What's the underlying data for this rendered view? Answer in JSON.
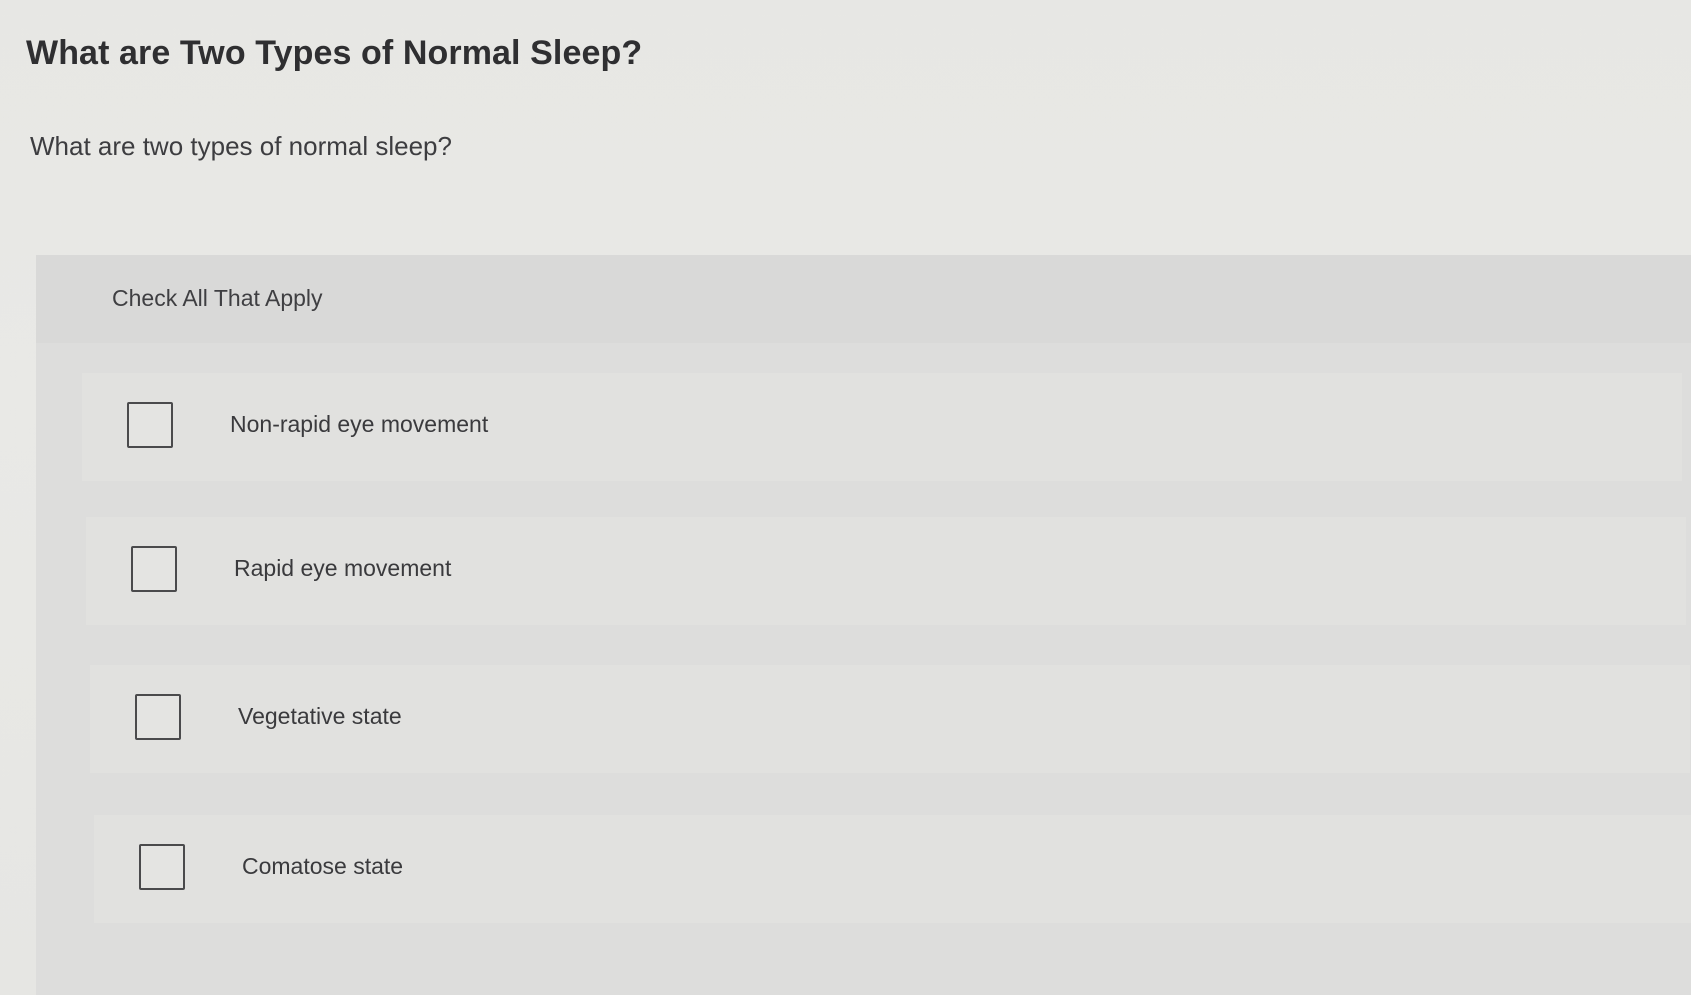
{
  "page": {
    "title": "What are Two Types of Normal Sleep?",
    "question": "What are two types of normal sleep?"
  },
  "answer_panel": {
    "instruction": "Check All That Apply",
    "options": [
      {
        "label": "Non-rapid eye movement",
        "checked": false
      },
      {
        "label": "Rapid eye movement",
        "checked": false
      },
      {
        "label": "Vegetative state",
        "checked": false
      },
      {
        "label": "Comatose state",
        "checked": false
      }
    ]
  },
  "colors": {
    "background": "#e7e7e4",
    "panel": "#dddddc",
    "option_row": "#e1e1df",
    "checkbox_border": "#4a4a4c",
    "text": "#3a3a3c"
  }
}
